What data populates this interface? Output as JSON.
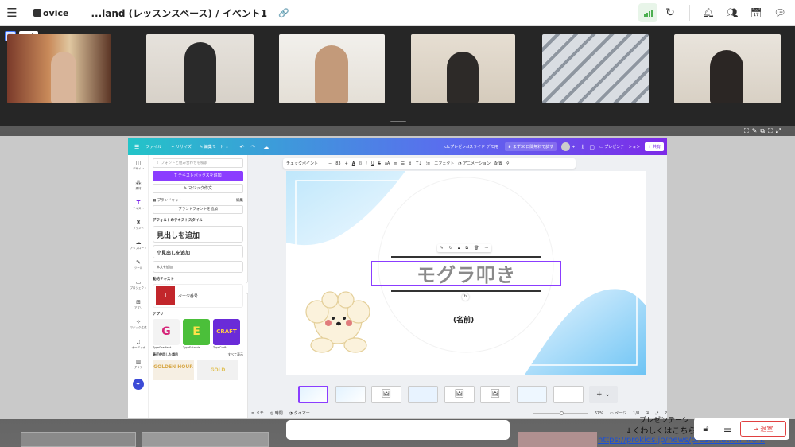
{
  "app": {
    "logo": "ovice",
    "title": "...land (レッスンスペース) / イベント1"
  },
  "canva": {
    "header": {
      "file": "ファイル",
      "resize": "リサイズ",
      "edit_mode": "編集モード",
      "doc_title": "clcプレゼンslスライド デモ用",
      "trial": "まず30日間無料で試す",
      "present": "プレゼンテーション",
      "share": "共有"
    },
    "rail": [
      "デザイン",
      "素材",
      "テキスト",
      "ブランド",
      "アップロード",
      "ツール",
      "プロジェクト",
      "アプリ",
      "マジック生成",
      "オーディオ",
      "グラフ"
    ],
    "panel": {
      "search_placeholder": "フォントと組み合わせを検索",
      "add_textbox": "テキストボックスを追加",
      "magic_write": "マジック作文",
      "brand_kit": "ブランドキット",
      "brand_edit": "編集",
      "add_brand_font": "ブランドフォントを追加",
      "default_styles": "デフォルトのテキストスタイル",
      "heading": "見出しを追加",
      "subheading": "小見出しを追加",
      "body": "本文を追加",
      "dynamic": "動的テキスト",
      "page_number": "ページ番号",
      "apps": "アプリ",
      "app_names": [
        "TypeGradient",
        "TypeExtrude",
        "TypeCraft"
      ],
      "recent": "最近使用した項目",
      "see_all": "すべて表示",
      "recent_items": [
        "GOLDEN HOUR",
        "GOLD"
      ]
    },
    "toolbar": {
      "font": "チェックポイント",
      "size": "83",
      "effect": "エフェクト",
      "animation": "アニメーション",
      "position": "配置"
    },
    "slide": {
      "title": "モグラ叩き",
      "name_label": "(名前)"
    },
    "footer": {
      "notes": "メモ",
      "duration": "時間",
      "timer": "タイマー",
      "zoom": "67%",
      "page": "ページ",
      "pages": "1/8"
    }
  },
  "bottom": {
    "overlay_text": "↓くわしくはこちら",
    "overlay_text2": "プレゼンテーシ",
    "url": "https://prokids.jp/news/presentation_worksh",
    "leave": "退室"
  }
}
